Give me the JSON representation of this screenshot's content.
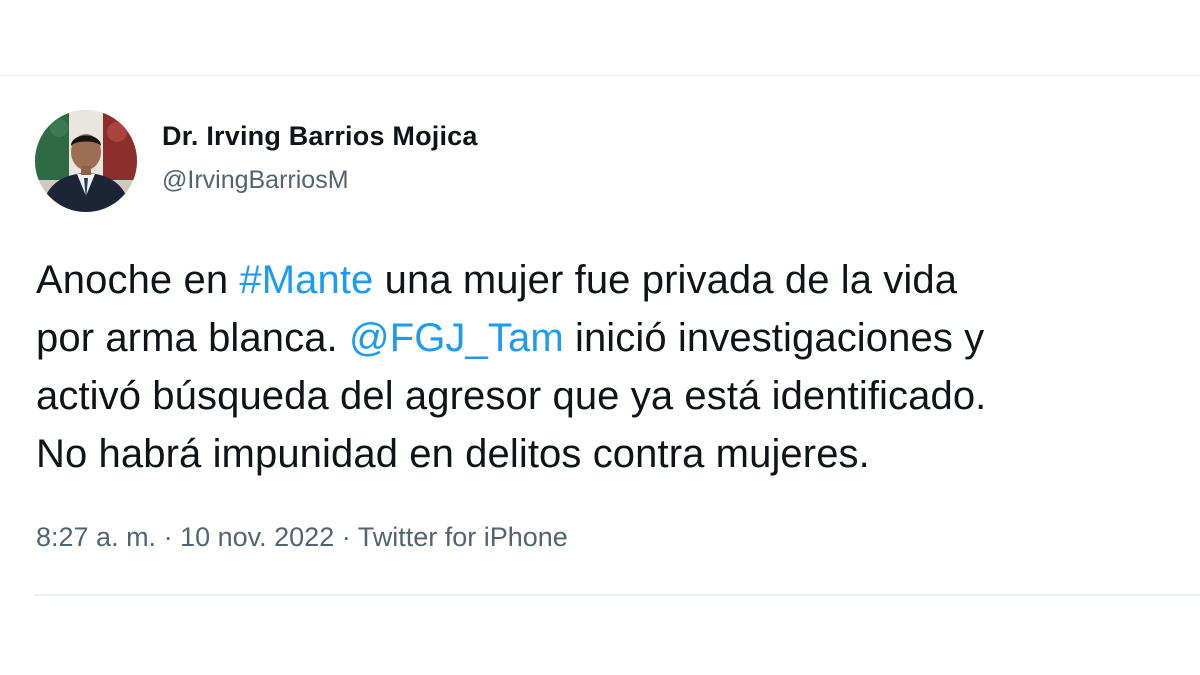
{
  "author": {
    "display_name": "Dr. Irving Barrios Mojica",
    "handle": "@IrvingBarriosM",
    "avatar_icon": "profile-photo"
  },
  "tweet": {
    "lines": [
      [
        {
          "text": "Anoche en ",
          "type": "text"
        },
        {
          "text": "#Mante",
          "type": "hashtag"
        },
        {
          "text": " una mujer fue privada de la vida",
          "type": "text"
        }
      ],
      [
        {
          "text": "por arma blanca. ",
          "type": "text"
        },
        {
          "text": "@FGJ_Tam",
          "type": "mention"
        },
        {
          "text": " inició investigaciones y",
          "type": "text"
        }
      ],
      [
        {
          "text": "activó búsqueda del agresor que ya está identificado.",
          "type": "text"
        }
      ],
      [
        {
          "text": "No habrá impunidad en delitos contra mujeres.",
          "type": "text"
        }
      ]
    ]
  },
  "meta": {
    "time": "8:27 a. m.",
    "separator": " · ",
    "date": "10 nov. 2022",
    "source": "Twitter for iPhone"
  },
  "colors": {
    "link": "#1d9bf0",
    "text": "#0f1419",
    "secondary": "#536471"
  }
}
